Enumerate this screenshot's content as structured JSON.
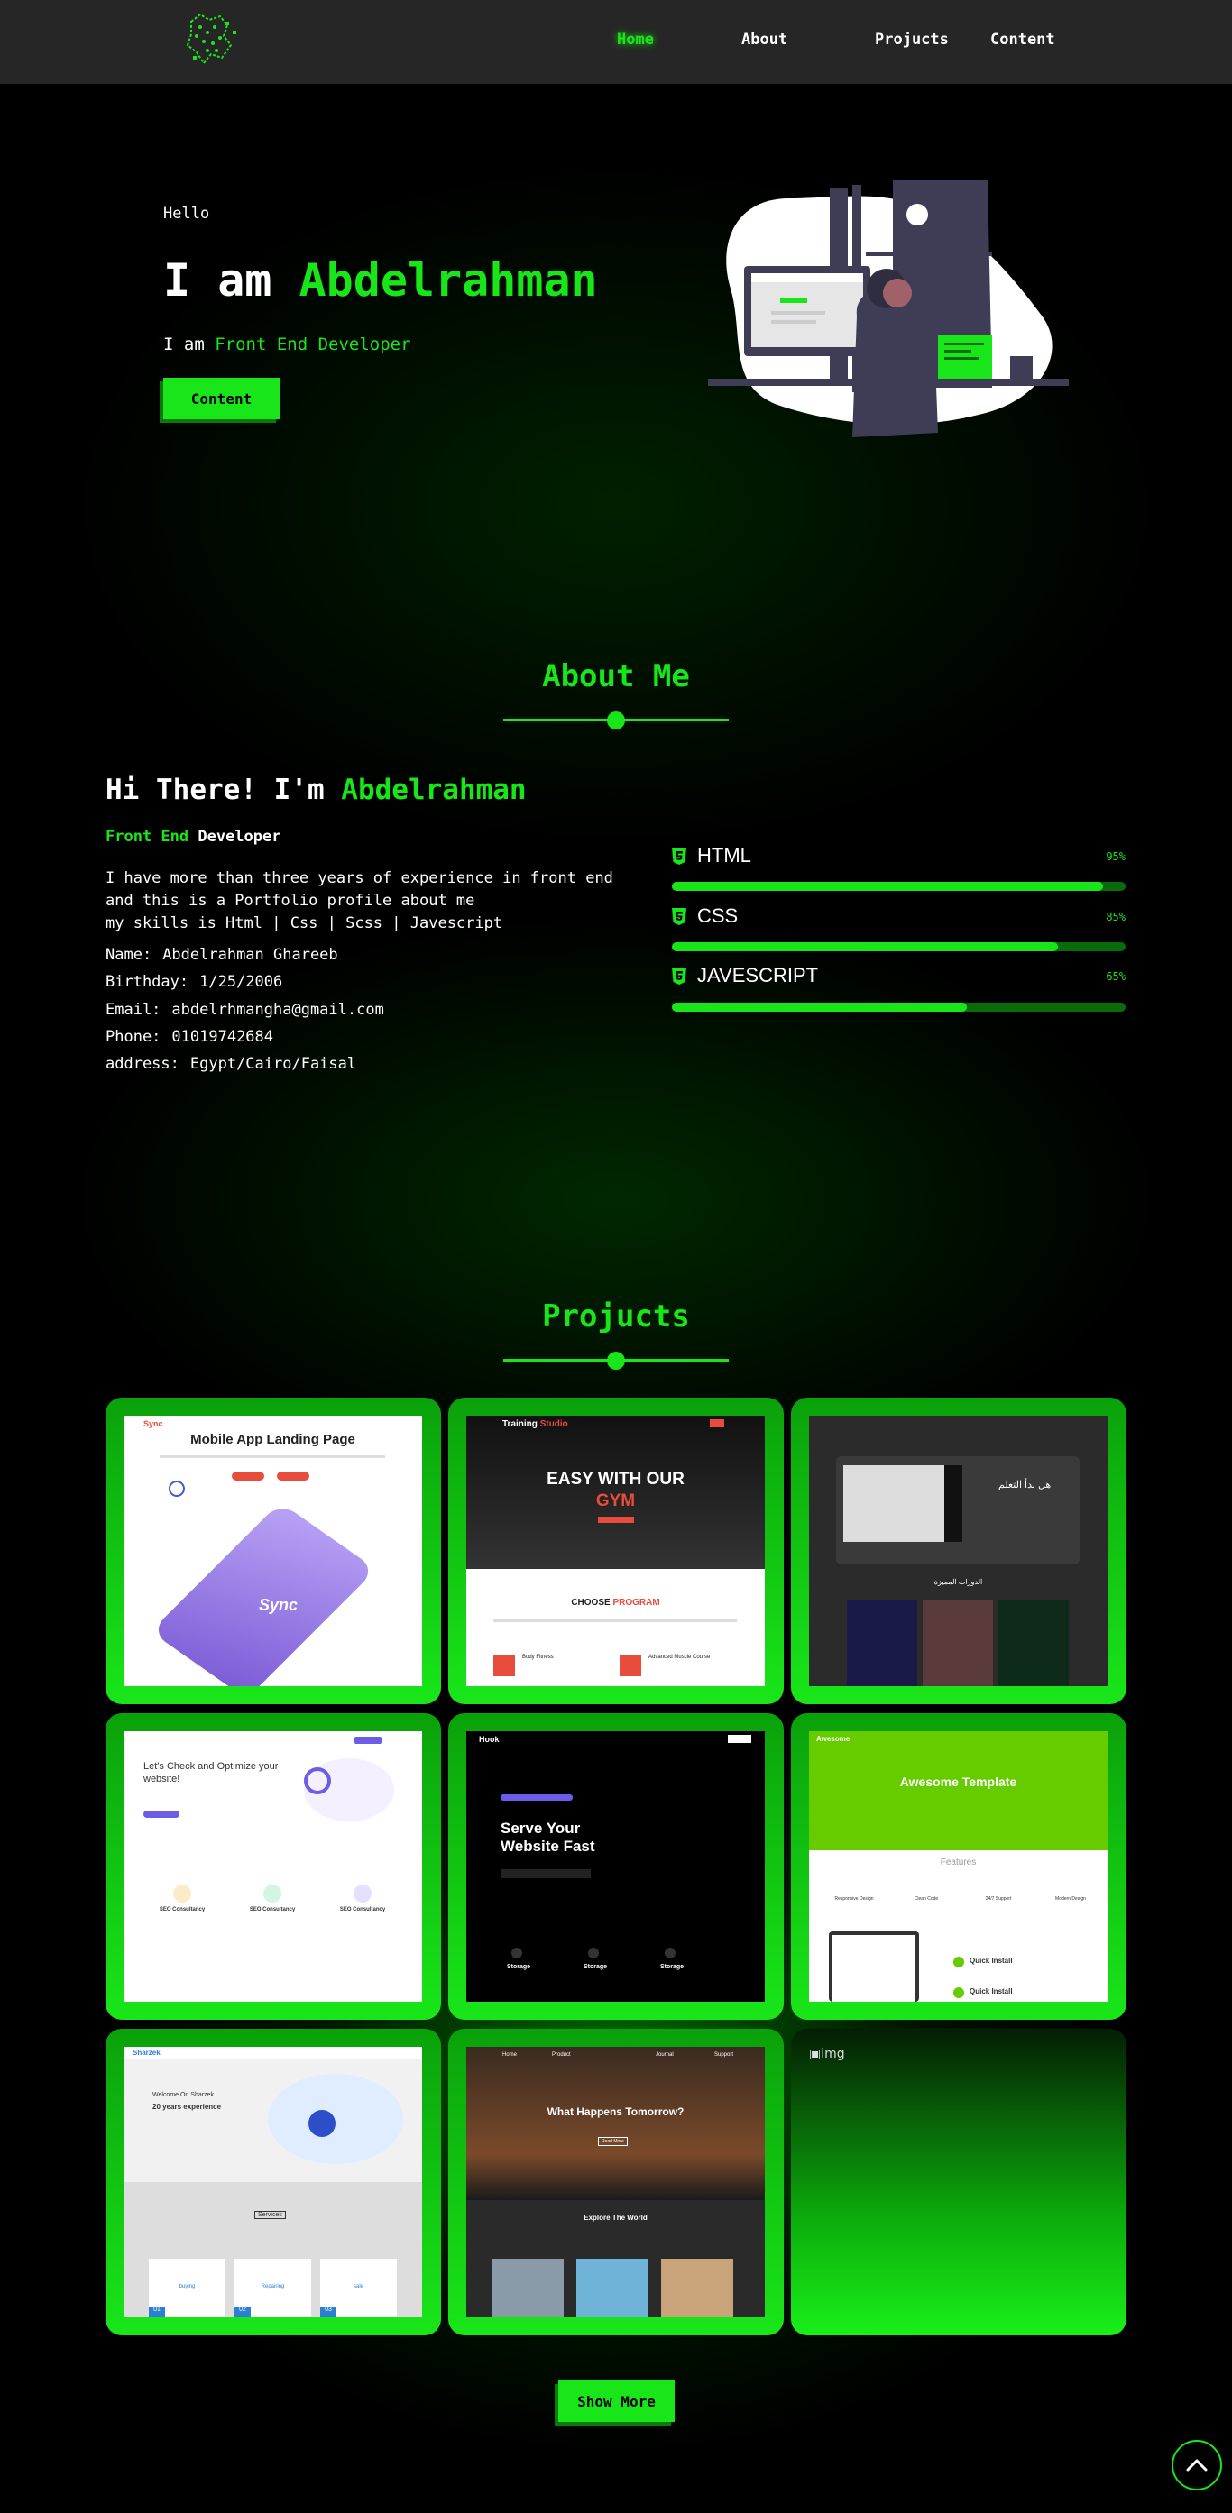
{
  "nav": {
    "links": [
      {
        "label": "Home",
        "active": true
      },
      {
        "label": "About",
        "active": false
      },
      {
        "label": "Projucts",
        "active": false
      },
      {
        "label": "Content",
        "active": false
      }
    ]
  },
  "hero": {
    "greeting": "Hello",
    "title_prefix": "I am ",
    "title_name": "Abdelrahman",
    "subtitle_prefix": "I am ",
    "subtitle_role": "Front End Developer",
    "button_label": "Content"
  },
  "about": {
    "section_title": "About Me",
    "heading_prefix": "Hi There! I'm ",
    "heading_name": "Abdelrahman",
    "role_green": "Front End ",
    "role_white": "Developer",
    "paragraph": [
      "I have more than three years of experience in front end",
      "and this is a Portfolio profile about me",
      "my skills is Html | Css | Scss | Javescript"
    ],
    "info": [
      {
        "label": "Name:",
        "value": "Abdelrahman Ghareeb"
      },
      {
        "label": "Birthday:",
        "value": "1/25/2006"
      },
      {
        "label": "Email:",
        "value": "abdelrhmangha@gmail.com"
      },
      {
        "label": "Phone:",
        "value": "01019742684"
      },
      {
        "label": "address:",
        "value": "Egypt/Cairo/Faisal"
      }
    ],
    "skills": [
      {
        "name": "HTML",
        "percent_label": "95%",
        "level": 0.95
      },
      {
        "name": "CSS",
        "percent_label": "85%",
        "level": 0.85
      },
      {
        "name": "JAVESCRIPT",
        "percent_label": "65%",
        "level": 0.65
      }
    ]
  },
  "projects": {
    "section_title": "Projucts",
    "thumbs": {
      "t1": {
        "brand": "Sync",
        "title": "Mobile App Landing Page",
        "phone_text": "Sync"
      },
      "t2": {
        "brand": "Training",
        "brand_accent": "Studio",
        "headline": "EASY WITH OUR",
        "headline_accent": "GYM",
        "section": "CHOOSE",
        "section_accent": "PROGRAM",
        "item1": "Body Fitness",
        "item2": "Advanced Muscle Course"
      },
      "t3": {
        "text1": "هل بدأ التعلم",
        "text2": "الدورات المميزة"
      },
      "t4": {
        "heading": "Let's Check and Optimize your website!",
        "card1": "SEO Consultancy",
        "card2": "SEO Consultancy",
        "card3": "SEO Consultancy"
      },
      "t5": {
        "brand": "Hook",
        "headline": "Serve Your Website Fast",
        "col1": "Storage",
        "col2": "Storage",
        "col3": "Storage"
      },
      "t6": {
        "brand": "Awesome",
        "headline": "Awesome Template",
        "features": "Features",
        "f1": "Responsive Design",
        "f2": "Clean Code",
        "f3": "24/7 Support",
        "f4": "Modern Design",
        "q1": "Quick Install",
        "q2": "Quick Install"
      },
      "t7": {
        "brand": "Sharzek",
        "welcome": "Welcome On Sharzek",
        "experience": "20 years experience",
        "services": "Services",
        "s1": "buying",
        "s2": "Repairing",
        "s3": "sale",
        "n1": "01",
        "n2": "02",
        "n3": "03"
      },
      "t8": {
        "nav1": "Home",
        "nav2": "Product",
        "nav3": "Journal",
        "nav4": "Support",
        "headline": "What Happens Tomorrow?",
        "button": "Read More",
        "section": "Explore The World"
      }
    },
    "broken_alt": "img",
    "button_label": "Show More"
  },
  "colors": {
    "accent": "#19e619",
    "nav_bg": "#262626"
  },
  "icons": {
    "back_to_top": "chevron-up-icon",
    "skill": "html5-shield-icon"
  }
}
